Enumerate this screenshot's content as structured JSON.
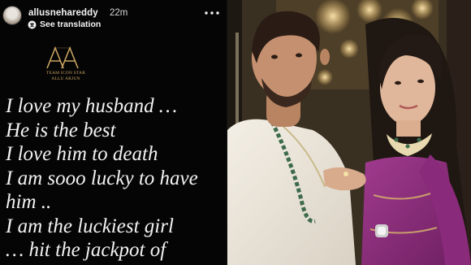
{
  "story": {
    "username": "allusnehareddy",
    "time_ago": "22m",
    "translate_label": "See translation",
    "logo": {
      "mark": "AA",
      "line1": "TEAM ICON STAR",
      "line2": "ALLU ARJUN"
    },
    "message_lines": [
      "I love my husband …",
      "He is the best",
      "I love him to death",
      "I am sooo lucky to have",
      "him ..",
      "I am the luckiest girl",
      "… hit the jackpot of"
    ]
  },
  "icons": {
    "more": "more-horizontal-icon",
    "translate": "translate-icon"
  },
  "colors": {
    "story_background": "#050505",
    "logo_gold": "#c8a261",
    "text": "#f2f2f2",
    "saree": "#8a2a7a"
  }
}
